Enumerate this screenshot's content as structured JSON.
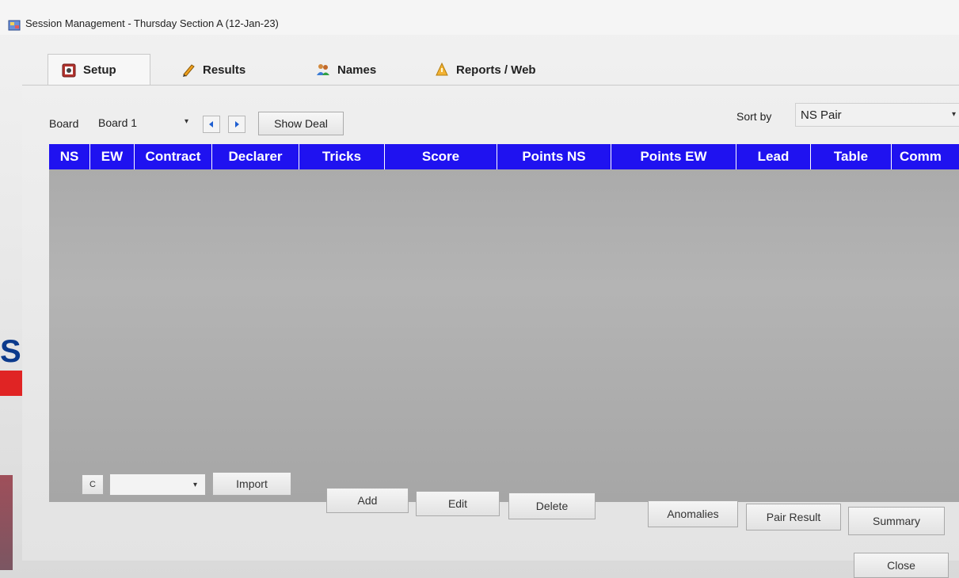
{
  "window": {
    "title": "Session Management - Thursday Section A (12-Jan-23)"
  },
  "tabs": [
    {
      "label": "Setup",
      "icon": "setup-icon"
    },
    {
      "label": "Results",
      "icon": "pencil-icon"
    },
    {
      "label": "Names",
      "icon": "people-icon"
    },
    {
      "label": "Reports / Web",
      "icon": "reports-icon"
    }
  ],
  "board": {
    "label": "Board",
    "value": "Board 1",
    "show_deal": "Show Deal"
  },
  "sort": {
    "label": "Sort by",
    "value": "NS Pair"
  },
  "grid": {
    "columns": [
      "NS",
      "EW",
      "Contract",
      "Declarer",
      "Tricks",
      "Score",
      "Points NS",
      "Points EW",
      "Lead",
      "Table",
      "Comm"
    ],
    "header_color": "#1f12f0",
    "rows": []
  },
  "buttons": {
    "c": "C",
    "import": "Import",
    "add": "Add",
    "edit": "Edit",
    "delete": "Delete",
    "anomalies": "Anomalies",
    "pair_result": "Pair Result",
    "summary": "Summary",
    "close": "Close"
  },
  "background": {
    "left_text": "SC"
  }
}
